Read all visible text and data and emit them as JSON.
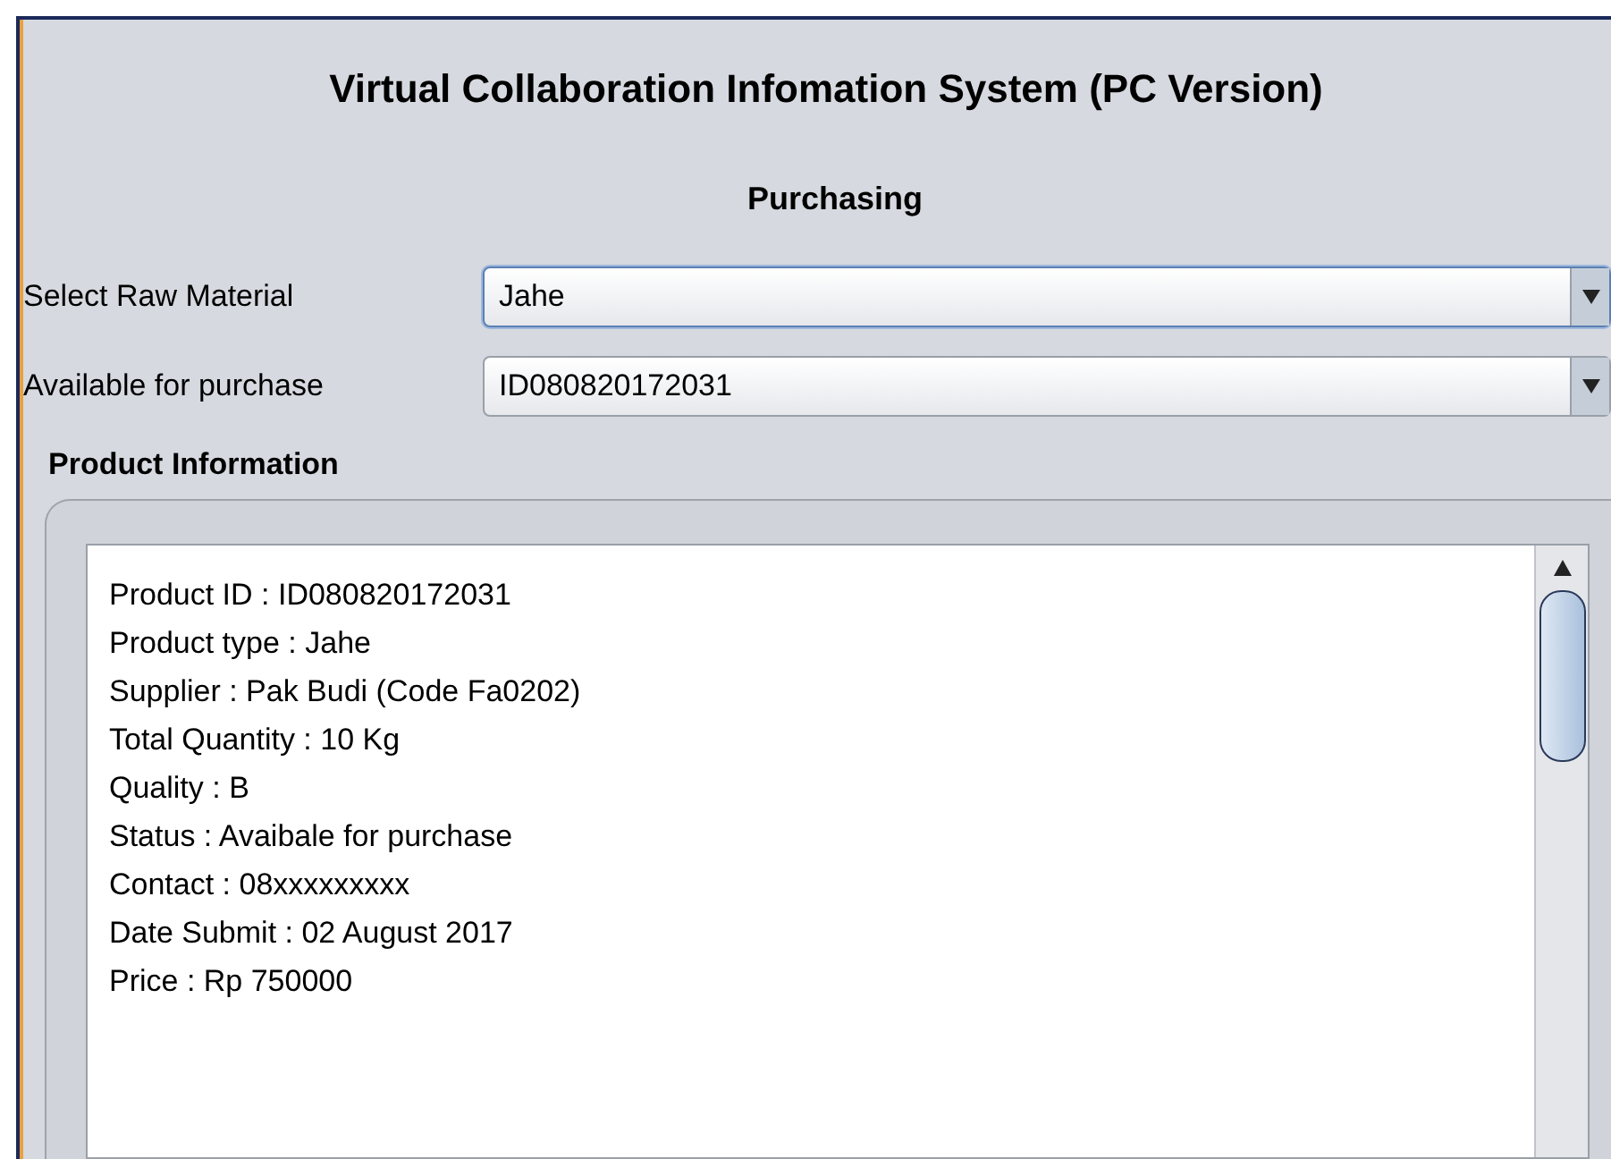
{
  "title": "Virtual Collaboration Infomation System (PC Version)",
  "subtitle": "Purchasing",
  "fields": [
    {
      "label": "Select Raw Material",
      "value": "Jahe",
      "focused": true
    },
    {
      "label": "Available for purchase",
      "value": "ID080820172031",
      "focused": false
    }
  ],
  "product_information": {
    "title": "Product Information",
    "lines": [
      "Product ID : ID080820172031",
      "Product type : Jahe",
      "Supplier : Pak Budi (Code Fa0202)",
      "Total Quantity : 10 Kg",
      "Quality : B",
      "Status : Avaibale for purchase",
      "Contact : 08xxxxxxxxx",
      "Date Submit : 02 August 2017",
      "Price : Rp 750000"
    ]
  }
}
